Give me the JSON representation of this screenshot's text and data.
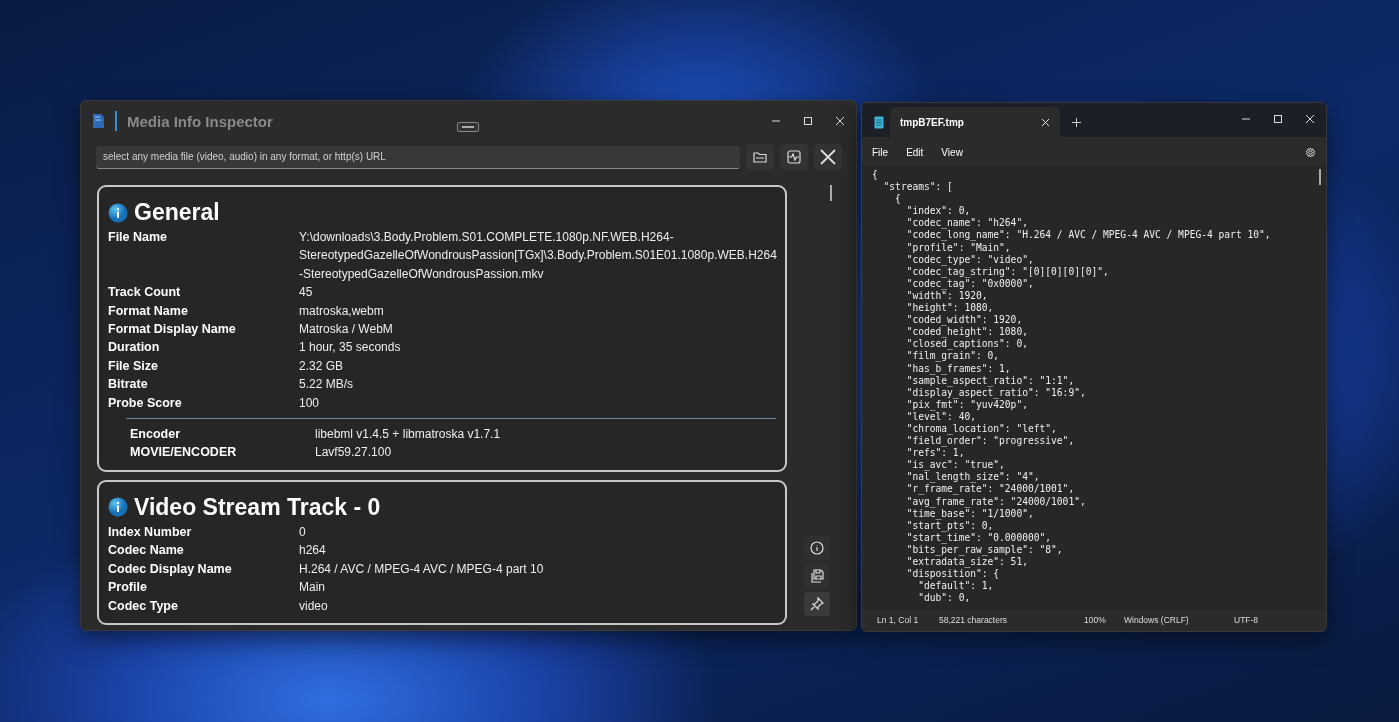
{
  "inspector": {
    "title": "Media Info Inspector",
    "search": {
      "placeholder": "select any media file (video, audio) in any format, or http(s) URL"
    },
    "sections": [
      {
        "title": "General",
        "rows": [
          {
            "label": "File Name",
            "value": "Y:\\downloads\\3.Body.Problem.S01.COMPLETE.1080p.NF.WEB.H264-StereotypedGazelleOfWondrousPassion[TGx]\\3.Body.Problem.S01E01.1080p.WEB.H264-StereotypedGazelleOfWondrousPassion.mkv"
          },
          {
            "label": "Track Count",
            "value": "45"
          },
          {
            "label": "Format Name",
            "value": "matroska,webm"
          },
          {
            "label": "Format Display Name",
            "value": "Matroska / WebM"
          },
          {
            "label": "Duration",
            "value": "1 hour, 35 seconds"
          },
          {
            "label": "File Size",
            "value": "2.32 GB"
          },
          {
            "label": "Bitrate",
            "value": "5.22 MB/s"
          },
          {
            "label": "Probe Score",
            "value": "100"
          }
        ],
        "tags": [
          {
            "label": "Encoder",
            "value": "libebml v1.4.5 + libmatroska v1.7.1"
          },
          {
            "label": "MOVIE/ENCODER",
            "value": "Lavf59.27.100"
          }
        ]
      },
      {
        "title": "Video Stream Track - 0",
        "rows": [
          {
            "label": "Index Number",
            "value": "0"
          },
          {
            "label": "Codec Name",
            "value": "h264"
          },
          {
            "label": "Codec Display Name",
            "value": "H.264 / AVC / MPEG-4 AVC / MPEG-4 part 10"
          },
          {
            "label": "Profile",
            "value": "Main"
          },
          {
            "label": "Codec Type",
            "value": "video"
          }
        ]
      }
    ]
  },
  "notepad": {
    "tab": "tmpB7EF.tmp",
    "menu": [
      "File",
      "Edit",
      "View"
    ],
    "lines": [
      "{",
      "  \"streams\": [",
      "    {",
      "      \"index\": 0,",
      "      \"codec_name\": \"h264\",",
      "      \"codec_long_name\": \"H.264 / AVC / MPEG-4 AVC / MPEG-4 part 10\",",
      "      \"profile\": \"Main\",",
      "      \"codec_type\": \"video\",",
      "      \"codec_tag_string\": \"[0][0][0][0]\",",
      "      \"codec_tag\": \"0x0000\",",
      "      \"width\": 1920,",
      "      \"height\": 1080,",
      "      \"coded_width\": 1920,",
      "      \"coded_height\": 1080,",
      "      \"closed_captions\": 0,",
      "      \"film_grain\": 0,",
      "      \"has_b_frames\": 1,",
      "      \"sample_aspect_ratio\": \"1:1\",",
      "      \"display_aspect_ratio\": \"16:9\",",
      "      \"pix_fmt\": \"yuv420p\",",
      "      \"level\": 40,",
      "      \"chroma_location\": \"left\",",
      "      \"field_order\": \"progressive\",",
      "      \"refs\": 1,",
      "      \"is_avc\": \"true\",",
      "      \"nal_length_size\": \"4\",",
      "      \"r_frame_rate\": \"24000/1001\",",
      "      \"avg_frame_rate\": \"24000/1001\",",
      "      \"time_base\": \"1/1000\",",
      "      \"start_pts\": 0,",
      "      \"start_time\": \"0.000000\",",
      "      \"bits_per_raw_sample\": \"8\",",
      "      \"extradata_size\": 51,",
      "      \"disposition\": {",
      "        \"default\": 1,",
      "        \"dub\": 0,"
    ],
    "status": [
      "Ln 1, Col 1",
      "58,221 characters",
      "100%",
      "Windows (CRLF)",
      "UTF-8"
    ]
  }
}
